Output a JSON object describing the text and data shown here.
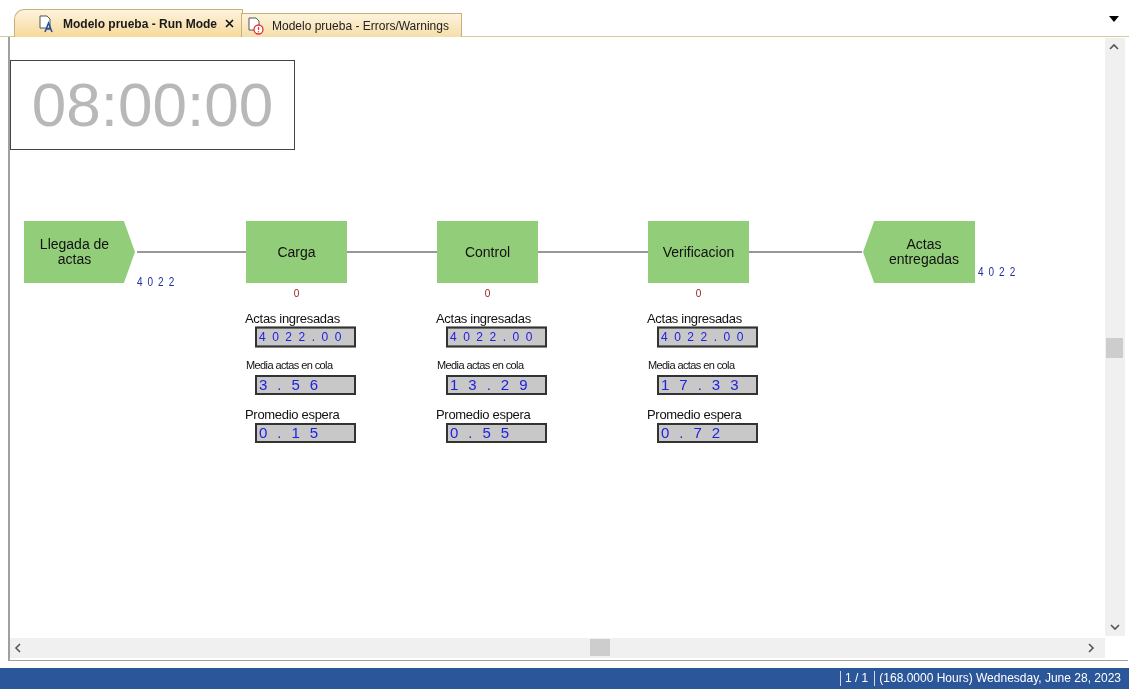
{
  "tabs": [
    {
      "label": "Modelo prueba - Run Mode",
      "selected": true,
      "kind": "run",
      "closable": true
    },
    {
      "label": "Modelo prueba - Errors/Warnings",
      "selected": false,
      "kind": "errors",
      "closable": false
    }
  ],
  "clock": "08:00:00",
  "nodes": [
    {
      "kind": "source",
      "label": "Llegada de actas",
      "count": "4022"
    },
    {
      "kind": "process",
      "label": "Carga",
      "queue": "0",
      "stats": [
        {
          "label": "Actas ingresadas",
          "value": "4022.00",
          "kind": "small"
        },
        {
          "label": "Media actas en cola",
          "value": "3.56",
          "kind": "large"
        },
        {
          "label": "Promedio espera",
          "value": "0.15",
          "kind": "large"
        }
      ]
    },
    {
      "kind": "process",
      "label": "Control",
      "queue": "0",
      "stats": [
        {
          "label": "Actas ingresadas",
          "value": "4022.00",
          "kind": "small"
        },
        {
          "label": "Media actas en cola",
          "value": "13.29",
          "kind": "large"
        },
        {
          "label": "Promedio espera",
          "value": "0.55",
          "kind": "large"
        }
      ]
    },
    {
      "kind": "process",
      "label": "Verificacion",
      "queue": "0",
      "stats": [
        {
          "label": "Actas ingresadas",
          "value": "4022.00",
          "kind": "small"
        },
        {
          "label": "Media actas en cola",
          "value": "17.33",
          "kind": "large"
        },
        {
          "label": "Promedio espera",
          "value": "0.72",
          "kind": "large"
        }
      ]
    },
    {
      "kind": "sink",
      "label": "Actas entregadas",
      "count": "4022"
    }
  ],
  "status_bar": [
    "1 / 1",
    "(168.0000 Hours) Wednesday, June 28, 2023"
  ]
}
